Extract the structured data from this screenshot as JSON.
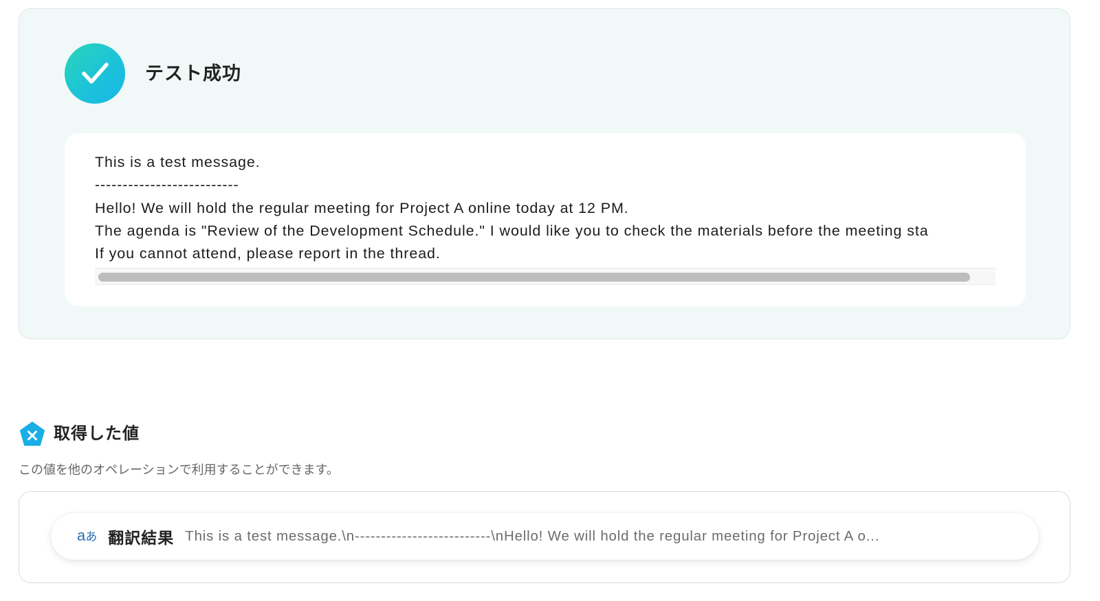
{
  "success": {
    "icon": "check-icon",
    "title": "テスト成功",
    "message_lines": [
      "This is a test message.",
      "--------------------------",
      "Hello! We will hold the regular meeting for Project A online today at 12 PM.",
      "The agenda is \"Review of the Development Schedule.\" I would like you to check the materials before the meeting sta",
      "If you cannot attend, please report in the thread."
    ],
    "accent_colors": [
      "#2ad6b8",
      "#17b6e8"
    ]
  },
  "obtained_values": {
    "icon": "variable-icon",
    "title": "取得した値",
    "description": "この値を他のオペレーションで利用することができます。",
    "items": [
      {
        "icon": "translate-icon",
        "label": "翻訳結果",
        "value": "This is a test message.\\n--------------------------\\nHello! We will hold the regular meeting for Project A o..."
      }
    ]
  }
}
